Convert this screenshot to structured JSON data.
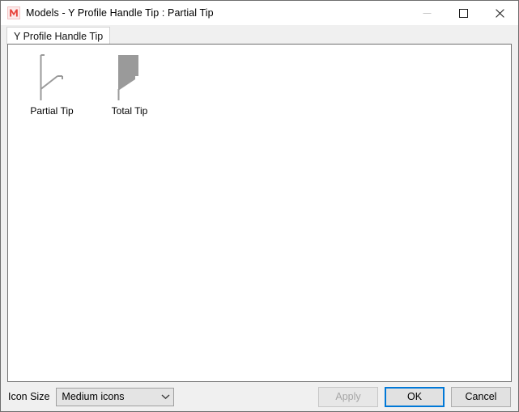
{
  "window": {
    "title": "Models - Y Profile Handle Tip : Partial Tip",
    "app_icon": "red-m-logo-icon",
    "controls": {
      "minimize_label": "minimize-icon",
      "maximize_label": "maximize-icon",
      "close_label": "close-icon"
    }
  },
  "tabs": [
    {
      "label": "Y Profile Handle Tip",
      "selected": true
    }
  ],
  "models": [
    {
      "label": "Partial Tip",
      "thumb": "partial-tip-outline-icon",
      "selected": true
    },
    {
      "label": "Total Tip",
      "thumb": "total-tip-filled-icon",
      "selected": false
    }
  ],
  "footer": {
    "icon_size_label": "Icon Size",
    "icon_size_value": "Medium icons",
    "icon_size_options": [
      "Medium icons"
    ],
    "apply_label": "Apply",
    "ok_label": "OK",
    "cancel_label": "Cancel"
  },
  "colors": {
    "accent": "#0078d7",
    "window_bg": "#f0f0f0",
    "panel_bg": "#ffffff",
    "icon_gray": "#9a9a9a",
    "logo_red": "#e8423a"
  }
}
